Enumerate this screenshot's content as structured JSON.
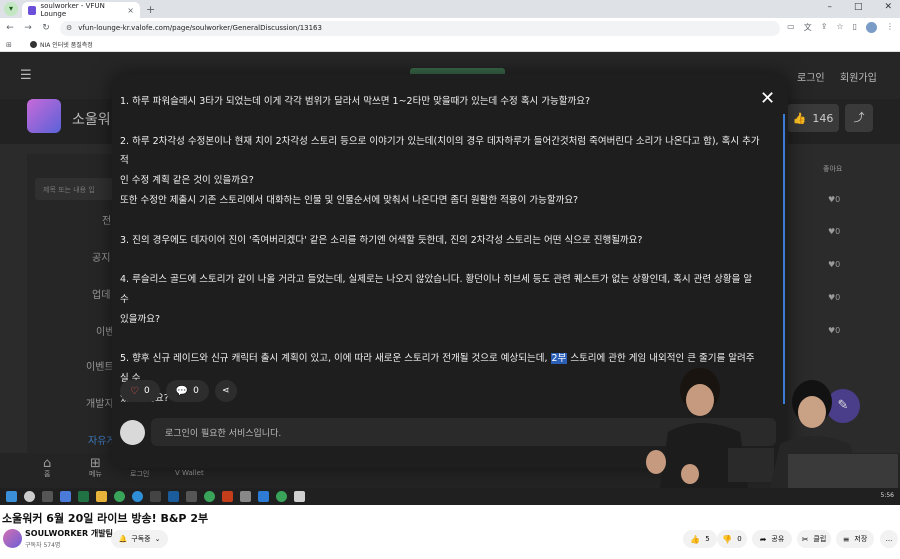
{
  "browser": {
    "tab_title": "soulworker - VFUN Lounge",
    "url": "vfun-lounge-kr.valofe.com/page/soulworker/GeneralDiscussion/13163",
    "bookmark": "NIA 인터넷 품질측정"
  },
  "site": {
    "login": "로그인",
    "signup": "회원가입",
    "game_title": "소울워",
    "like_count": "146",
    "search_placeholder": "제목 또는 내용 입",
    "side_items": [
      "전",
      "공지",
      "업데",
      "이벤",
      "이벤트",
      "개발지",
      "자유게"
    ],
    "col_like": "좋아요",
    "like_cells": [
      "0",
      "0",
      "0",
      "0",
      "0"
    ],
    "bottom_nav": [
      "홈",
      "메뉴",
      "로그인",
      "V Wallet"
    ]
  },
  "modal": {
    "q1": "1. 하루 파워슬래시 3타가 되었는데 이게 각각 범위가 달라서 막쓰면 1~2타만 맞을때가 있는데 수정 혹시 가능할까요?",
    "q2a": "2. 하루 2차각성 수정본이나 현재 치이 2차각성 스토리 등으로 이야기가 있는데(치이의 경우 데자하루가 들어간것처럼 죽여버린다 소리가 나온다고 함), 혹시 추가적",
    "q2b": "인 수정 계획 같은 것이 있을까요?",
    "q2c": "또한 수정안 제출시 기존 스토리에서 대화하는 인물 및 인물순서에 맞춰서 나온다면 좀더 원활한 적용이 가능할까요?",
    "q3": "3. 진의 경우에도 데자이어 진이 '죽여버리겠다' 같은 소리를 하기엔 어색할 듯한데, 진의 2차각성 스토리는 어떤 식으로 진행될까요?",
    "q4a": "4. 루슬리스 골드에 스토리가 같이 나올 거라고 들었는데, 실제로는 나오지 않았습니다. 황던이나 히브세 등도 관련 퀘스트가 없는 상황인데, 혹시 관련 상황을 알 수",
    "q4b": "있을까요?",
    "q5a_pre": "5. 향후 신규 레이드와 신규 캐릭터 출시 계획이 있고, 이에 따라 새로운 스토리가 전개될 것으로 예상되는데, ",
    "q5a_hl": "2부",
    "q5a_post": " 스토리에 관한 게임 내외적인 큰 줄기를 알려주실 수",
    "q5b": "있으신가요?",
    "like_count": "0",
    "comment_count": "0",
    "comment_placeholder": "로그인이 필요한 서비스입니다."
  },
  "taskbar": {
    "clock": "5:56"
  },
  "youtube": {
    "title": "소울워커 6월 20일 라이브 방송! B&P 2부",
    "channel": "SOULWORKER 개발팀",
    "subscribers": "구독자 574명",
    "subscribe_label": "구독중",
    "likes": "5",
    "dislikes": "0",
    "share": "공유",
    "clip": "클립",
    "save": "저장",
    "more": "..."
  }
}
